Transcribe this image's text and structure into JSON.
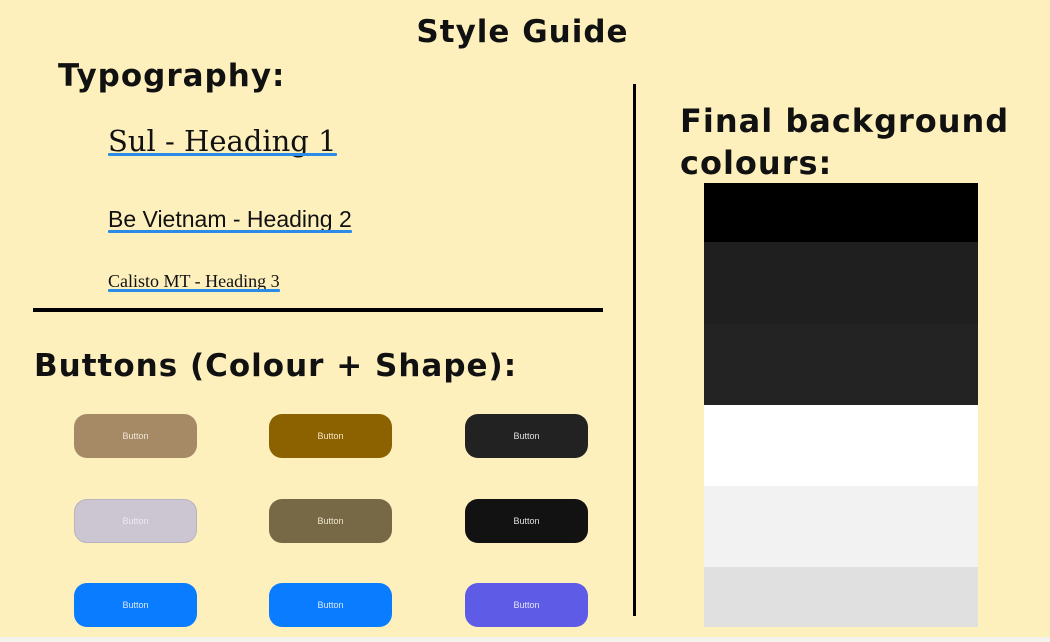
{
  "title": "Style Guide",
  "typography": {
    "heading": "Typography:",
    "samples": [
      {
        "text": "Sul - Heading 1"
      },
      {
        "text": "Be Vietnam - Heading 2"
      },
      {
        "text": "Calisto MT - Heading 3"
      }
    ]
  },
  "buttons_section": {
    "heading": "Buttons (Colour + Shape):",
    "buttons": [
      {
        "label": "Button",
        "color": "#a68a66",
        "text_color": "#f0e6d6"
      },
      {
        "label": "Button",
        "color": "#8c6200",
        "text_color": "#f3e6c4"
      },
      {
        "label": "Button",
        "color": "#222222",
        "text_color": "#e0e0e0"
      },
      {
        "label": "Button",
        "color": "#cbc6d1",
        "text_color": "#ece9f0"
      },
      {
        "label": "Button",
        "color": "#776945",
        "text_color": "#eee6cf"
      },
      {
        "label": "Button",
        "color": "#121212",
        "text_color": "#e0e0e0"
      },
      {
        "label": "Button",
        "color": "#0a7cff",
        "text_color": "#dce9ff"
      },
      {
        "label": "Button",
        "color": "#0a7cff",
        "text_color": "#dce9ff"
      },
      {
        "label": "Button",
        "color": "#5e5ce6",
        "text_color": "#e4e3ff"
      }
    ]
  },
  "background_section": {
    "heading_line1": "Final background",
    "heading_line2": "colours:",
    "swatches": [
      {
        "color": "#000000"
      },
      {
        "color": "#1f1f1f"
      },
      {
        "color": "#232323"
      },
      {
        "color": "#ffffff"
      },
      {
        "color": "#f2f2f2"
      },
      {
        "color": "#e0e0e0"
      }
    ]
  }
}
